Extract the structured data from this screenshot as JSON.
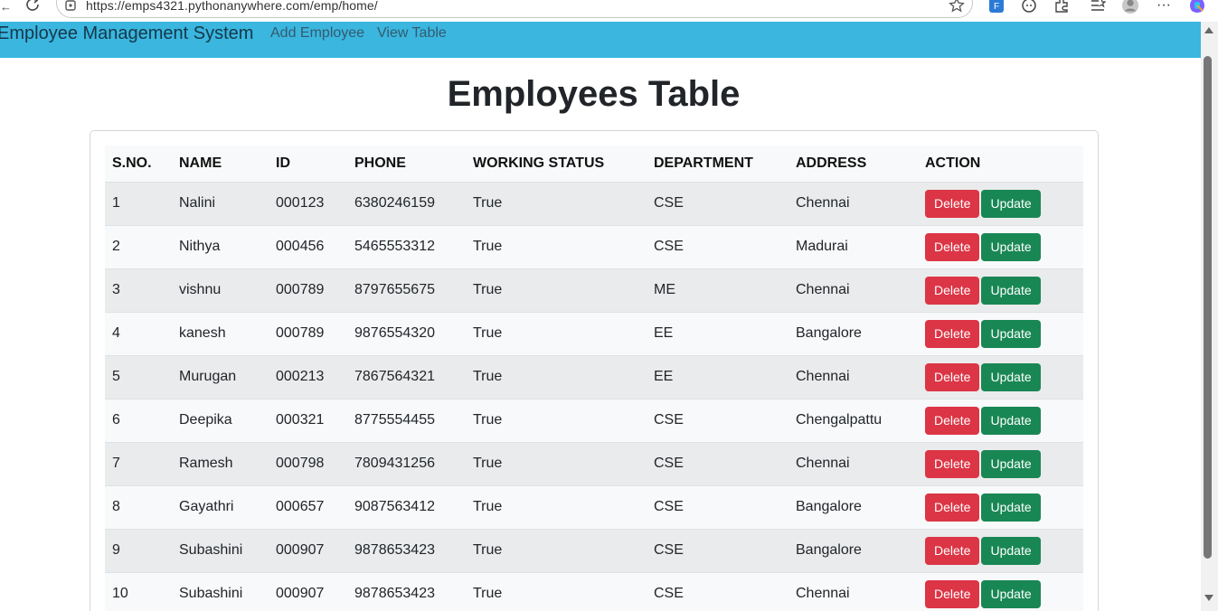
{
  "browser": {
    "url": "https://emps4321.pythonanywhere.com/emp/home/"
  },
  "navbar": {
    "brand": "Employee Management System",
    "links": [
      "Add Employee",
      "View Table"
    ],
    "color": "#3ab6df"
  },
  "page": {
    "title": "Employees Table"
  },
  "table": {
    "headers": [
      "S.NO.",
      "NAME",
      "ID",
      "PHONE",
      "WORKING STATUS",
      "DEPARTMENT",
      "ADDRESS",
      "ACTION"
    ],
    "delete_label": "Delete",
    "update_label": "Update",
    "rows": [
      {
        "sno": "1",
        "name": "Nalini",
        "id": "000123",
        "phone": "6380246159",
        "status": "True",
        "dept": "CSE",
        "address": "Chennai"
      },
      {
        "sno": "2",
        "name": "Nithya",
        "id": "000456",
        "phone": "5465553312",
        "status": "True",
        "dept": "CSE",
        "address": "Madurai"
      },
      {
        "sno": "3",
        "name": "vishnu",
        "id": "000789",
        "phone": "8797655675",
        "status": "True",
        "dept": "ME",
        "address": "Chennai"
      },
      {
        "sno": "4",
        "name": "kanesh",
        "id": "000789",
        "phone": "9876554320",
        "status": "True",
        "dept": "EE",
        "address": "Bangalore"
      },
      {
        "sno": "5",
        "name": "Murugan",
        "id": "000213",
        "phone": "7867564321",
        "status": "True",
        "dept": "EE",
        "address": "Chennai"
      },
      {
        "sno": "6",
        "name": "Deepika",
        "id": "000321",
        "phone": "8775554455",
        "status": "True",
        "dept": "CSE",
        "address": "Chengalpattu"
      },
      {
        "sno": "7",
        "name": "Ramesh",
        "id": "000798",
        "phone": "7809431256",
        "status": "True",
        "dept": "CSE",
        "address": "Chennai"
      },
      {
        "sno": "8",
        "name": "Gayathri",
        "id": "000657",
        "phone": "9087563412",
        "status": "True",
        "dept": "CSE",
        "address": "Bangalore"
      },
      {
        "sno": "9",
        "name": "Subashini",
        "id": "000907",
        "phone": "9878653423",
        "status": "True",
        "dept": "CSE",
        "address": "Bangalore"
      },
      {
        "sno": "10",
        "name": "Subashini",
        "id": "000907",
        "phone": "9878653423",
        "status": "True",
        "dept": "CSE",
        "address": "Chennai"
      }
    ]
  },
  "colors": {
    "delete": "#dc3545",
    "update": "#198754"
  }
}
